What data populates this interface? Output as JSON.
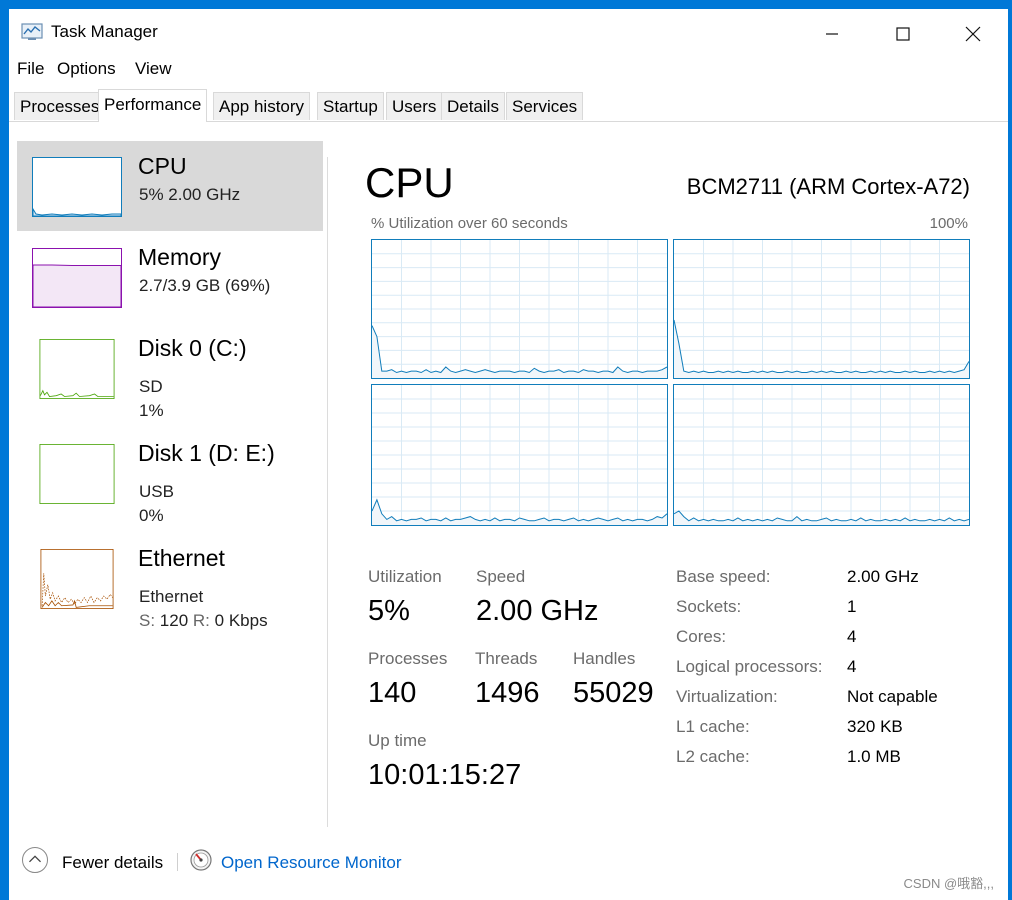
{
  "window": {
    "title": "Task Manager"
  },
  "menu": [
    "File",
    "Options",
    "View"
  ],
  "tabs": [
    "Processes",
    "Performance",
    "App history",
    "Startup",
    "Users",
    "Details",
    "Services"
  ],
  "active_tab": "Performance",
  "sidebar": [
    {
      "title": "CPU",
      "line1": "5%  2.00 GHz",
      "color": "#117dbb",
      "selected": true
    },
    {
      "title": "Memory",
      "line1": "2.7/3.9 GB (69%)",
      "color": "#8b12ae"
    },
    {
      "title": "Disk 0 (C:)",
      "line1": "SD",
      "line2": "1%",
      "color": "#4da60c"
    },
    {
      "title": "Disk 1 (D: E:)",
      "line1": "USB",
      "line2": "0%",
      "color": "#4da60c"
    },
    {
      "title": "Ethernet",
      "line1": "Ethernet",
      "s_label": "S:",
      "s_value": "120",
      "r_label": "R:",
      "r_value": "0 Kbps",
      "color": "#a74f01"
    }
  ],
  "main": {
    "title": "CPU",
    "model": "BCM2711 (ARM Cortex-A72)",
    "graph_label": "% Utilization over 60 seconds",
    "graph_max": "100%",
    "stats": {
      "utilization_label": "Utilization",
      "utilization": "5%",
      "speed_label": "Speed",
      "speed": "2.00 GHz",
      "processes_label": "Processes",
      "processes": "140",
      "threads_label": "Threads",
      "threads": "1496",
      "handles_label": "Handles",
      "handles": "55029",
      "uptime_label": "Up time",
      "uptime": "10:01:15:27"
    },
    "details": [
      {
        "label": "Base speed:",
        "value": "2.00 GHz"
      },
      {
        "label": "Sockets:",
        "value": "1"
      },
      {
        "label": "Cores:",
        "value": "4"
      },
      {
        "label": "Logical processors:",
        "value": "4"
      },
      {
        "label": "Virtualization:",
        "value": "Not capable"
      },
      {
        "label": "L1 cache:",
        "value": "320 KB"
      },
      {
        "label": "L2 cache:",
        "value": "1.0 MB"
      }
    ]
  },
  "footer": {
    "fewer_details": "Fewer details",
    "open_resource_monitor": "Open Resource Monitor"
  },
  "watermark": "CSDN @哦豁,,,",
  "icons": {
    "app": "task-manager-icon",
    "minimize": "minimize-icon",
    "maximize": "maximize-icon",
    "close": "close-icon",
    "fewer": "chevron-up-icon",
    "resource_monitor": "resource-monitor-icon"
  },
  "colors": {
    "accent": "#117dbb",
    "selection": "#d9d9d9",
    "link": "#0066cc"
  },
  "chart_data": {
    "type": "line",
    "title": "% Utilization over 60 seconds",
    "ylim": [
      0,
      100
    ],
    "y_max_label": "100%",
    "grid": true,
    "series": [
      {
        "values": [
          38,
          30,
          5,
          5,
          6,
          4,
          5,
          4,
          5,
          5,
          4,
          6,
          4,
          5,
          4,
          8,
          5,
          4,
          5,
          6,
          5,
          4,
          5,
          6,
          5,
          4,
          5,
          5,
          5,
          4,
          5,
          5,
          4,
          7,
          5,
          4,
          5,
          5,
          6,
          4,
          5,
          5,
          4,
          6,
          5,
          5,
          4,
          5,
          5,
          4,
          8,
          5,
          4,
          5,
          5,
          4,
          5,
          5,
          5,
          6,
          8
        ]
      },
      {
        "values": [
          42,
          25,
          5,
          4,
          5,
          4,
          5,
          4,
          4,
          5,
          4,
          5,
          4,
          5,
          4,
          4,
          5,
          4,
          5,
          4,
          5,
          4,
          4,
          5,
          4,
          5,
          4,
          4,
          5,
          4,
          5,
          4,
          5,
          4,
          4,
          5,
          4,
          5,
          4,
          4,
          5,
          4,
          5,
          4,
          5,
          4,
          4,
          5,
          4,
          5,
          4,
          4,
          5,
          4,
          5,
          4,
          5,
          4,
          5,
          6,
          12
        ]
      },
      {
        "values": [
          10,
          18,
          8,
          4,
          6,
          3,
          4,
          3,
          4,
          4,
          5,
          3,
          4,
          4,
          3,
          5,
          3,
          4,
          4,
          5,
          6,
          4,
          3,
          4,
          3,
          5,
          3,
          4,
          4,
          3,
          5,
          4,
          3,
          3,
          4,
          5,
          3,
          4,
          4,
          3,
          4,
          5,
          3,
          4,
          3,
          4,
          5,
          4,
          3,
          4,
          5,
          3,
          4,
          3,
          4,
          4,
          3,
          4,
          6,
          5,
          8
        ]
      },
      {
        "values": [
          8,
          10,
          6,
          3,
          5,
          3,
          4,
          3,
          4,
          3,
          3,
          4,
          3,
          5,
          3,
          4,
          3,
          4,
          3,
          4,
          3,
          5,
          4,
          3,
          3,
          6,
          3,
          4,
          3,
          3,
          4,
          5,
          3,
          4,
          3,
          3,
          4,
          3,
          5,
          3,
          4,
          3,
          3,
          4,
          3,
          4,
          3,
          5,
          3,
          4,
          3,
          3,
          4,
          3,
          4,
          3,
          5,
          3,
          4,
          3,
          4
        ]
      }
    ]
  }
}
